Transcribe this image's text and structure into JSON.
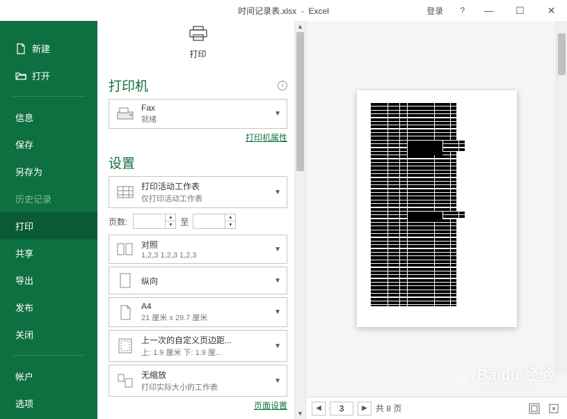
{
  "titlebar": {
    "filename": "时间记录表.xlsx",
    "app": "Excel",
    "signin": "登录",
    "help": "?"
  },
  "sidebar": {
    "new": "新建",
    "open": "打开",
    "info": "信息",
    "save": "保存",
    "saveas": "另存为",
    "history": "历史记录",
    "print": "打印",
    "share": "共享",
    "export": "导出",
    "publish": "发布",
    "close": "关闭",
    "account": "帐户",
    "options": "选项"
  },
  "print": {
    "button_label": "打印",
    "printer_heading": "打印机",
    "printer_name": "Fax",
    "printer_status": "就绪",
    "printer_props": "打印机属性",
    "settings_heading": "设置",
    "pages_label": "页数:",
    "pages_to": "至",
    "page_setup": "页面设置",
    "options": {
      "sheets": {
        "title": "打印活动工作表",
        "sub": "仅打印活动工作表"
      },
      "collate": {
        "title": "对照",
        "sub": "1,2,3    1,2,3    1,2,3"
      },
      "orient": {
        "title": "纵向",
        "sub": ""
      },
      "paper": {
        "title": "A4",
        "sub": "21 厘米 x 29.7 厘米"
      },
      "margins": {
        "title": "上一次的自定义页边距...",
        "sub": "上: 1.9 厘米 下: 1.9 厘..."
      },
      "scale": {
        "title": "无缩放",
        "sub": "打印实际大小的工作表"
      }
    }
  },
  "preview": {
    "current_page": "3",
    "total_pages_label": "共 8 页"
  },
  "watermark": {
    "brand": "Baidu 经验",
    "url": "jingyan.baidu.com"
  }
}
